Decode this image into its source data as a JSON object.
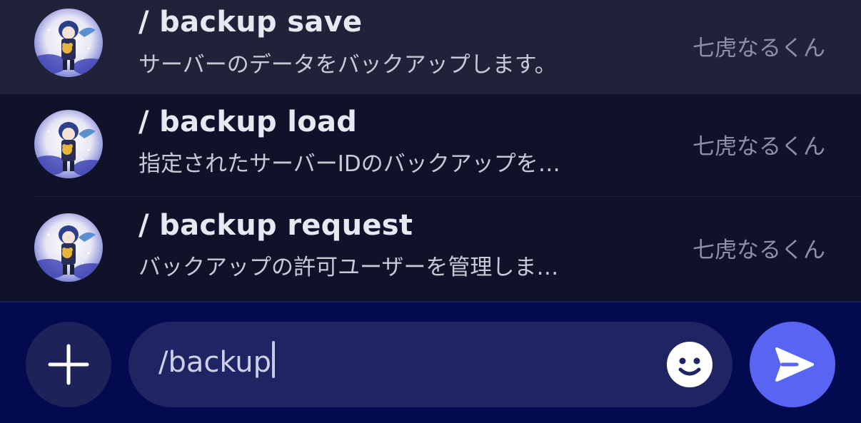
{
  "suggestions": [
    {
      "command": "/ backup save",
      "description": "サーバーのデータをバックアップします。",
      "bot": "七虎なるくん",
      "avatar_icon": "bot-avatar-icon",
      "highlighted": true
    },
    {
      "command": "/ backup load",
      "description": "指定されたサーバーIDのバックアップを…",
      "bot": "七虎なるくん",
      "avatar_icon": "bot-avatar-icon",
      "highlighted": false
    },
    {
      "command": "/ backup request",
      "description": "バックアップの許可ユーザーを管理しま…",
      "bot": "七虎なるくん",
      "avatar_icon": "bot-avatar-icon",
      "highlighted": false
    }
  ],
  "composer": {
    "value": "/backup",
    "plus_icon": "plus-icon",
    "emoji_icon": "emoji-icon",
    "send_icon": "send-icon"
  },
  "colors": {
    "background": "#10122a",
    "highlight_row": "#20223a",
    "composer_bg": "#030a4f",
    "input_bg": "#1f2563",
    "send_button": "#5865f2"
  }
}
